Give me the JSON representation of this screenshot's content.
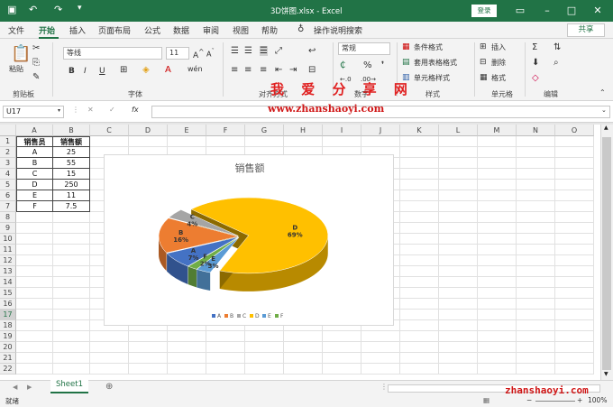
{
  "window": {
    "title": "3D饼图.xlsx  -  Excel",
    "login": "登录",
    "share": "共享"
  },
  "menu": [
    "文件",
    "开始",
    "插入",
    "页面布局",
    "公式",
    "数据",
    "审阅",
    "视图",
    "帮助"
  ],
  "search_hint": "操作说明搜索",
  "ribbon": {
    "paste": "粘贴",
    "font_name": "等线",
    "font_size": "11",
    "bold": "B",
    "italic": "I",
    "underline": "U",
    "number_format": "常规",
    "cond_format": "条件格式",
    "table_format": "套用表格格式",
    "cell_style": "单元格样式",
    "insert": "插入",
    "delete": "删除",
    "format": "格式",
    "groups": [
      "剪贴板",
      "字体",
      "对齐方式",
      "数字",
      "样式",
      "单元格",
      "编辑"
    ]
  },
  "formula_bar": {
    "name_box": "U17",
    "fx": "fx",
    "formula": ""
  },
  "columns": [
    "A",
    "B",
    "C",
    "D",
    "E",
    "F",
    "G",
    "H",
    "I",
    "J",
    "K",
    "L",
    "M",
    "N",
    "O"
  ],
  "rows": [
    "1",
    "2",
    "3",
    "4",
    "5",
    "6",
    "7",
    "8",
    "9",
    "10",
    "11",
    "12",
    "13",
    "14",
    "15",
    "16",
    "17",
    "18",
    "19",
    "20",
    "21",
    "22"
  ],
  "table": {
    "headers": [
      "销售员",
      "销售额"
    ],
    "rows": [
      [
        "A",
        "25"
      ],
      [
        "B",
        "55"
      ],
      [
        "C",
        "15"
      ],
      [
        "D",
        "250"
      ],
      [
        "E",
        "11"
      ],
      [
        "F",
        "7.5"
      ]
    ]
  },
  "chart_data": {
    "type": "pie",
    "title": "销售额",
    "categories": [
      "A",
      "B",
      "C",
      "D",
      "E",
      "F"
    ],
    "values": [
      25,
      55,
      15,
      250,
      11,
      7.5
    ],
    "percent_labels": [
      "7%",
      "16%",
      "4%",
      "69%",
      "3%",
      "2%"
    ],
    "colors": [
      "#4472c4",
      "#ed7d31",
      "#a5a5a5",
      "#ffc000",
      "#5b9bd5",
      "#70ad47"
    ],
    "legend_position": "bottom",
    "three_d": true,
    "exploded_slice": "D"
  },
  "sheet_tab": "Sheet1",
  "status": {
    "mode": "就绪",
    "zoom": "100%"
  },
  "watermark": {
    "cn": "我 爱 分 享 网",
    "url": "www.zhanshaoyi.com",
    "url2": "zhanshaoyi.com"
  }
}
